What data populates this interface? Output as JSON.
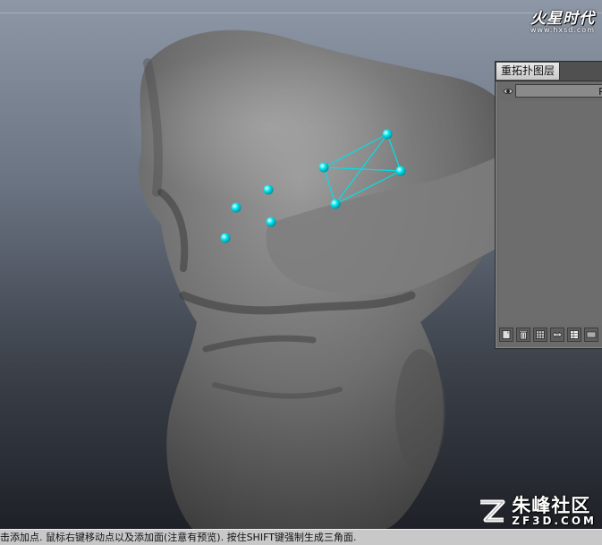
{
  "watermark_top": {
    "name": "火星时代",
    "url": "www.hxsd.com"
  },
  "panel": {
    "tab_label": "重拓扑图层",
    "layer_name": "Re"
  },
  "toolbar_icons": [
    "new-layer-icon",
    "trash-icon",
    "grid-icon",
    "swap-icon",
    "table-icon",
    "film-icon"
  ],
  "status_text": "击添加点. 鼠标右键移动点以及添加面(注意有预览). 按住SHIFT键强制生成三角面.",
  "watermark_bottom": {
    "name": "朱峰社区",
    "url": "ZF3D.COM"
  },
  "colors": {
    "point": "#00e5ee",
    "edge": "#00e0e8"
  }
}
